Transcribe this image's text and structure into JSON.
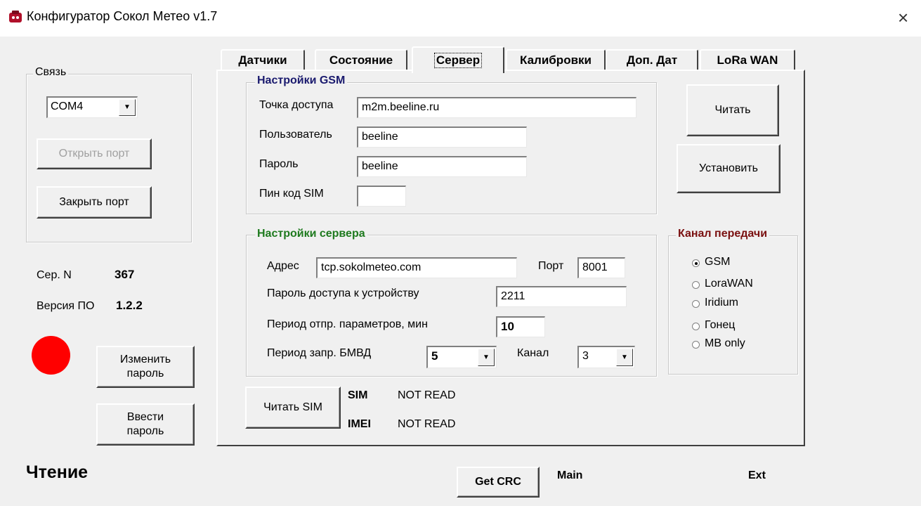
{
  "window": {
    "title": "Конфигуратор Сокол Метео v1.7",
    "close_symbol": "×"
  },
  "connection": {
    "group_label": "Связь",
    "port_value": "COM4",
    "open_port_label": "Открыть порт",
    "close_port_label": "Закрыть порт"
  },
  "device": {
    "serial_label": "Сер. N",
    "serial_value": "367",
    "firmware_label": "Версия ПО",
    "firmware_value": "1.2.2",
    "indicator_color": "#ff0000",
    "change_password_label": "Изменить пароль",
    "enter_password_label": "Ввести пароль"
  },
  "tabs": [
    {
      "label": "Датчики"
    },
    {
      "label": "Состояние"
    },
    {
      "label": "Сервер"
    },
    {
      "label": "Калибровки"
    },
    {
      "label": "Доп. Дат"
    },
    {
      "label": "LoRa WAN"
    }
  ],
  "gsm": {
    "group_label": "Настройки GSM",
    "apn_label": "Точка доступа",
    "apn_value": "m2m.beeline.ru",
    "user_label": "Пользователь",
    "user_value": "beeline",
    "password_label": "Пароль",
    "password_value": "beeline",
    "pin_label": "Пин код SIM",
    "pin_value": ""
  },
  "actions": {
    "read_label": "Читать",
    "set_label": "Установить"
  },
  "server": {
    "group_label": "Настройки сервера",
    "address_label": "Адрес",
    "address_value": "tcp.sokolmeteo.com",
    "port_label": "Порт",
    "port_value": "8001",
    "access_password_label": "Пароль доступа к устройству",
    "access_password_value": "2211",
    "send_period_label": "Период отпр. параметров, мин",
    "send_period_value": "10",
    "bmvd_period_label": "Период запр.  БМВД",
    "bmvd_period_value": "5",
    "channel_label": "Канал",
    "channel_value": "3"
  },
  "transmission": {
    "group_label": "Канал передачи",
    "options": [
      {
        "label": "GSM",
        "checked": true
      },
      {
        "label": "LoraWAN",
        "checked": false
      },
      {
        "label": "Iridium",
        "checked": false
      },
      {
        "label": "Гонец",
        "checked": false
      },
      {
        "label": "MB only",
        "checked": false
      }
    ]
  },
  "sim": {
    "read_sim_label": "Читать SIM",
    "sim_label": "SIM",
    "sim_value": "NOT READ",
    "imei_label": "IMEI",
    "imei_value": "NOT READ"
  },
  "footer": {
    "status_text": "Чтение",
    "get_crc_label": "Get CRC",
    "main_label": "Main",
    "ext_label": "Ext"
  },
  "colors": {
    "gsm_group_title": "#1a1a6e",
    "server_group_title": "#1e7a1e",
    "transmission_group_title": "#7a1010"
  }
}
